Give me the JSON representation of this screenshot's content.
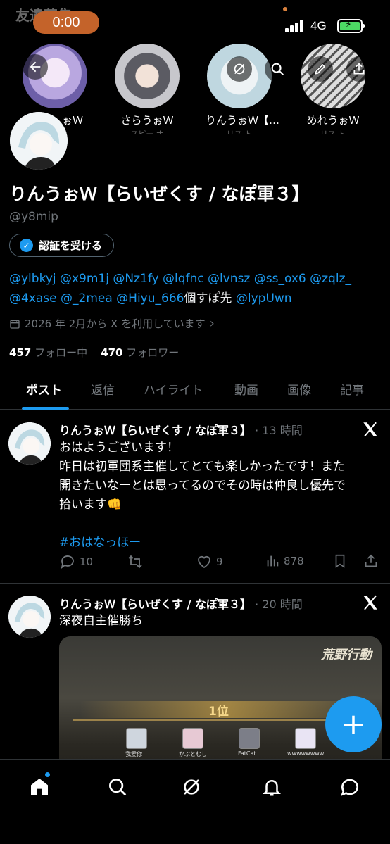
{
  "status_bar": {
    "time": "0:00",
    "network": "4G",
    "peek_title": "友達募集"
  },
  "friends": [
    {
      "name": "ぉＷ",
      "sub": ""
    },
    {
      "name": "さらうぉＷ",
      "sub": "スピー ナ"
    },
    {
      "name": "りんうぉＷ【…",
      "sub": "リス ト"
    },
    {
      "name": "めれうぉＷ",
      "sub": "リス ト"
    }
  ],
  "header_icons": {
    "back": "back-arrow-icon",
    "grok": "grok-icon",
    "search": "search-icon",
    "edit": "edit-icon",
    "share": "share-icon"
  },
  "profile": {
    "name": "りんうぉＷ【らいぜくす / なぽ軍３】",
    "handle": "@y8mip",
    "verify_label": "認証を受ける",
    "bio_line1": "@ylbkyj @x9m1j @Nz1fy @lqfnc @lvnsz @ss_ox6 @zqlz_",
    "bio_line2_mentions": "@4xase @_2mea @Hiyu_666",
    "bio_line2_text": "個すぽ先",
    "bio_line2_tail": "@lypUwn",
    "joined": "2026 年 2月から X を利用しています",
    "following_count": "457",
    "following_label": "フォロー中",
    "followers_count": "470",
    "followers_label": "フォロワー"
  },
  "tabs": [
    "ポスト",
    "返信",
    "ハイライト",
    "動画",
    "画像",
    "記事"
  ],
  "tweets": [
    {
      "name": "りんうぉＷ【らいぜくす / なぽ軍３】",
      "time": "· 13 時間",
      "line1": "おはようございます！",
      "line2": "昨日は初軍団系主催してとても楽しかったです！また",
      "line3": "開きたいなーとは思ってるのでその時は仲良し優先で",
      "line4": "拾います👊",
      "hashtag": "#おはなっほー",
      "replies": "10",
      "retweets": "",
      "likes": "9",
      "views": "878"
    },
    {
      "name": "りんうぉＷ【らいぜくす / なぽ軍３】",
      "time": "· 20 時間",
      "text": "深夜自主催勝ち",
      "media": {
        "brand": "荒野行動",
        "rank": "1位",
        "players": [
          "我爱你",
          "かぶとむし",
          "FatCat.",
          "wwwwwwww"
        ]
      }
    }
  ],
  "fab_label": "+",
  "colors": {
    "accent": "#1d9bf0",
    "background": "#000000",
    "secondary_text": "#71767b",
    "time_pill": "#c4632a"
  }
}
